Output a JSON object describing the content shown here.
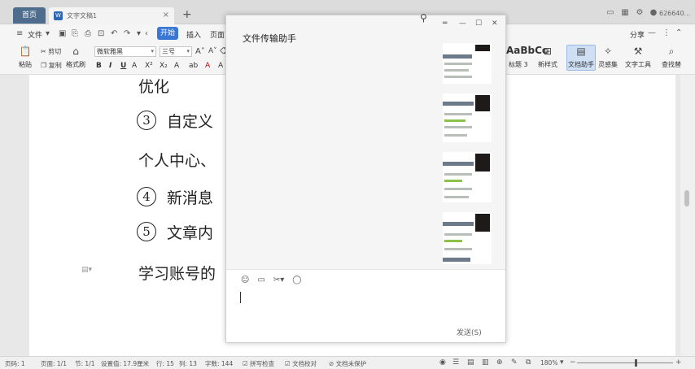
{
  "titlebar": {
    "home_tab": "首页",
    "doc_tab": "文字文稿1",
    "doc_icon_label": "W",
    "close_label": "×",
    "plus_label": "+",
    "user": "626640..."
  },
  "menubar": {
    "file": "文件",
    "start": "开始",
    "insert": "插入",
    "layout": "页面",
    "share": "分享"
  },
  "ribbon": {
    "paste": "粘贴",
    "cut": "剪切",
    "copy": "复制",
    "format_painter": "格式刷",
    "font_name": "微软雅黑",
    "font_size": "三号",
    "bold": "B",
    "italic": "I",
    "underline": "U",
    "abc_preview": "AaBbCc",
    "heading": "标题 3",
    "new_style": "新样式",
    "doc_assistant": "文档助手",
    "inspiration": "灵感集",
    "text_tools": "文字工具",
    "find_replace": "查找替"
  },
  "document": {
    "line1": "优化",
    "item3_num": "3",
    "item3_text": "自定义",
    "line_personal": "个人中心、",
    "item4_num": "4",
    "item4_text": "新消息",
    "item5_num": "5",
    "item5_text": "文章内",
    "line_study": "学习账号的"
  },
  "chat": {
    "title": "文件传输助手",
    "send": "发送(S)"
  },
  "statusbar": {
    "page": "页码: 1",
    "pages": "页面: 1/1",
    "section": "节: 1/1",
    "setting": "设置值: 17.9厘米",
    "row": "行: 15",
    "col": "列: 13",
    "words": "字数: 144",
    "spell": "拼写检查",
    "proofread": "文档校对",
    "unprotected": "文档未保护",
    "zoom": "180%"
  }
}
